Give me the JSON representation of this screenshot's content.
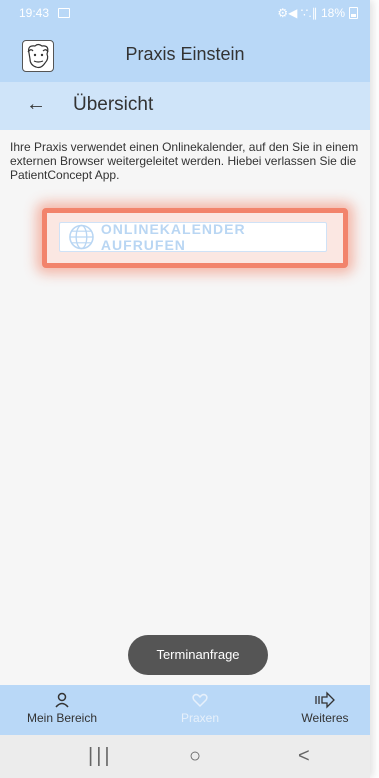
{
  "statusbar": {
    "time": "19:43",
    "right_text": "⚙◀ ∵.∥ 18%"
  },
  "appbar": {
    "title": "Praxis Einstein"
  },
  "subbar": {
    "back_icon": "←",
    "title": "Übersicht"
  },
  "content": {
    "info_text": "Ihre Praxis verwendet einen Onlinekalender, auf den Sie in einem externen Browser weitergeleitet werden. Hiebei verlassen Sie die PatientConcept App.",
    "cta_label": "ONLINEKALENDER AUFRUFEN"
  },
  "fab": {
    "label": "Terminanfrage"
  },
  "bottomnav": {
    "items": [
      {
        "label": "Mein Bereich",
        "icon": "person-icon"
      },
      {
        "label": "Praxen",
        "icon": "heart-icon"
      },
      {
        "label": "Weiteres",
        "icon": "arrow-right-icon"
      }
    ]
  },
  "sysnav": {
    "recents": "|||",
    "home": "○",
    "back": "<"
  },
  "colors": {
    "header_bg": "#b9d8f7",
    "subheader_bg": "#cfe4f9",
    "highlight": "#f2846c",
    "cta_text": "#b9d6f3"
  }
}
